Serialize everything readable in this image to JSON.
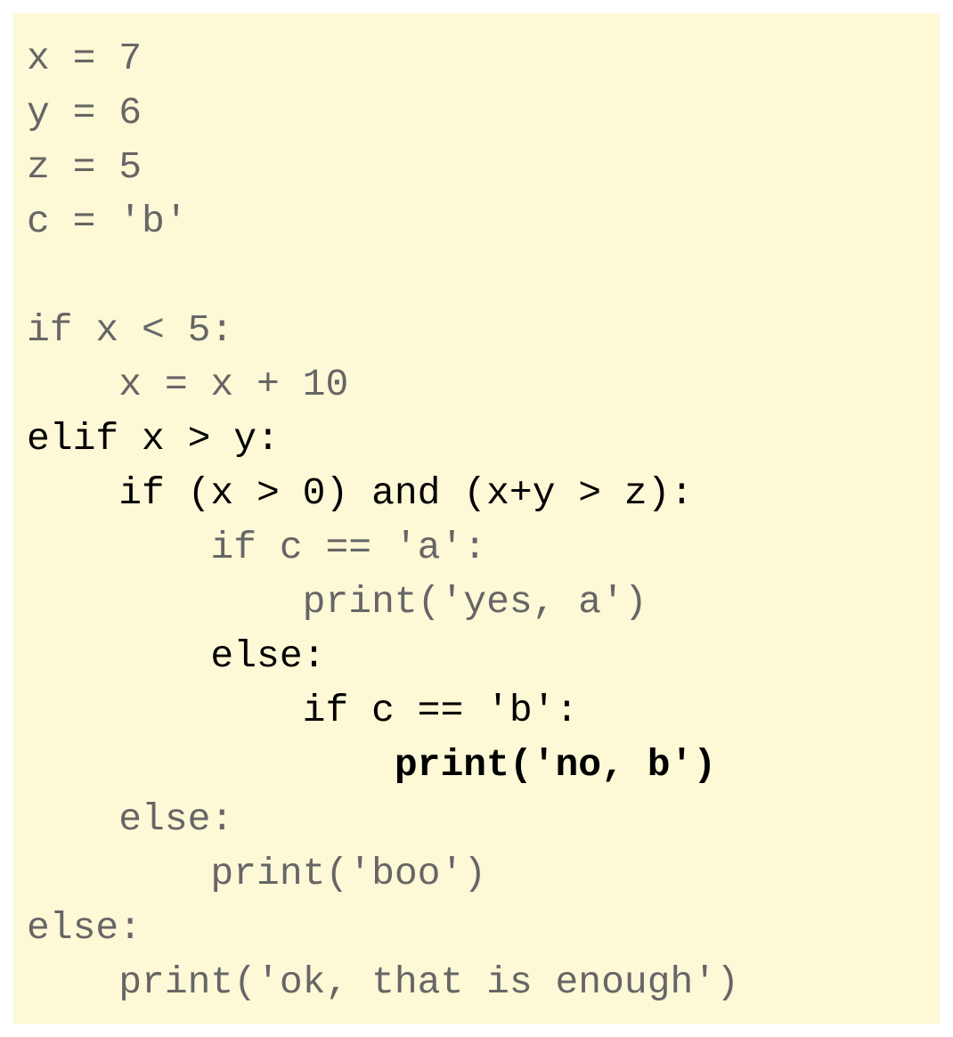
{
  "code": {
    "lines": [
      {
        "text": "x = 7",
        "state": "dim"
      },
      {
        "text": "y = 6",
        "state": "dim"
      },
      {
        "text": "z = 5",
        "state": "dim"
      },
      {
        "text": "c = 'b'",
        "state": "dim"
      },
      {
        "text": "",
        "state": "dim"
      },
      {
        "text": "if x < 5:",
        "state": "dim"
      },
      {
        "text": "    x = x + 10",
        "state": "dim"
      },
      {
        "text": "elif x > y:",
        "state": "active"
      },
      {
        "text": "    if (x > 0) and (x+y > z):",
        "state": "active"
      },
      {
        "text": "        if c == 'a':",
        "state": "dim"
      },
      {
        "text": "            print('yes, a')",
        "state": "dim"
      },
      {
        "text": "        else:",
        "state": "active"
      },
      {
        "text": "            if c == 'b':",
        "state": "active"
      },
      {
        "text": "                print('no, b')",
        "state": "current"
      },
      {
        "text": "    else:",
        "state": "dim"
      },
      {
        "text": "        print('boo')",
        "state": "dim"
      },
      {
        "text": "else:",
        "state": "dim"
      },
      {
        "text": "    print('ok, that is enough')",
        "state": "dim"
      }
    ]
  }
}
